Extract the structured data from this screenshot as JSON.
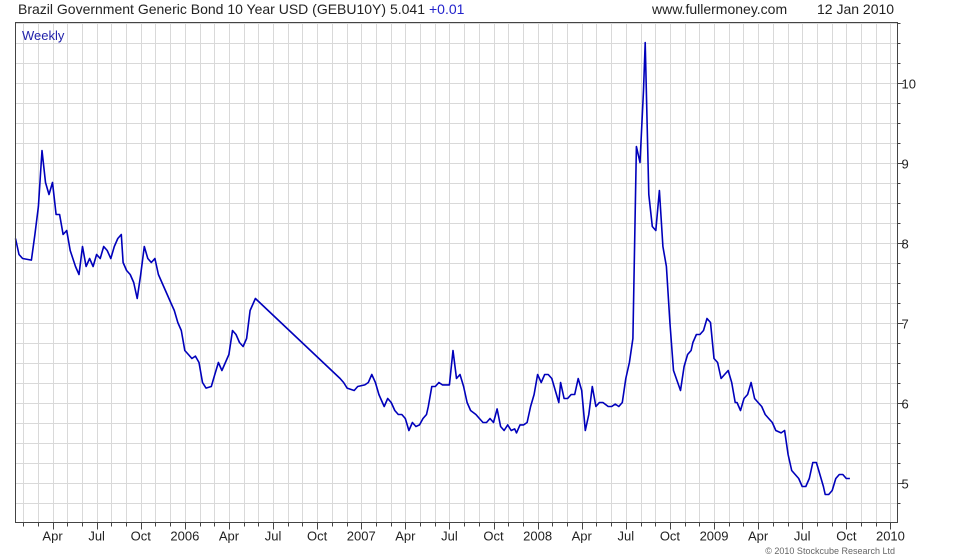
{
  "header": {
    "title": "Brazil Government Generic Bond 10 Year USD (GEBU10Y)",
    "last": "5.041",
    "change": "+0.01",
    "site": "www.fullermoney.com",
    "date": "12 Jan 2010"
  },
  "chart_label": "Weekly",
  "copyright": "© 2010 Stockcube Research Ltd",
  "colors": {
    "series": "#0000bb",
    "grid": "#d9d9d9",
    "frame": "#444444",
    "change": "#2222cc"
  },
  "chart_data": {
    "type": "line",
    "title": "Brazil Government Generic Bond 10 Year USD (GEBU10Y)",
    "xlabel": "",
    "ylabel": "",
    "x_range": [
      2005.04,
      2010.04
    ],
    "ylim": [
      4.5,
      10.75
    ],
    "y_ticks": [
      5,
      6,
      7,
      8,
      9,
      10
    ],
    "x_ticks": [
      {
        "label": "Apr",
        "x": 2005.25
      },
      {
        "label": "Jul",
        "x": 2005.5
      },
      {
        "label": "Oct",
        "x": 2005.75
      },
      {
        "label": "2006",
        "x": 2006.0
      },
      {
        "label": "Apr",
        "x": 2006.25
      },
      {
        "label": "Jul",
        "x": 2006.5
      },
      {
        "label": "Oct",
        "x": 2006.75
      },
      {
        "label": "2007",
        "x": 2007.0
      },
      {
        "label": "Apr",
        "x": 2007.25
      },
      {
        "label": "Jul",
        "x": 2007.5
      },
      {
        "label": "Oct",
        "x": 2007.75
      },
      {
        "label": "2008",
        "x": 2008.0
      },
      {
        "label": "Apr",
        "x": 2008.25
      },
      {
        "label": "Jul",
        "x": 2008.5
      },
      {
        "label": "Oct",
        "x": 2008.75
      },
      {
        "label": "2009",
        "x": 2009.0
      },
      {
        "label": "Apr",
        "x": 2009.25
      },
      {
        "label": "Jul",
        "x": 2009.5
      },
      {
        "label": "Oct",
        "x": 2009.75
      },
      {
        "label": "2010",
        "x": 2010.0
      }
    ],
    "grid": true,
    "y_axis_side": "right",
    "series": [
      {
        "values": [
          [
            2005.04,
            8.05
          ],
          [
            2005.06,
            7.85
          ],
          [
            2005.08,
            7.8
          ],
          [
            2005.13,
            7.78
          ],
          [
            2005.15,
            8.1
          ],
          [
            2005.17,
            8.45
          ],
          [
            2005.19,
            9.15
          ],
          [
            2005.21,
            8.75
          ],
          [
            2005.23,
            8.6
          ],
          [
            2005.25,
            8.75
          ],
          [
            2005.27,
            8.35
          ],
          [
            2005.29,
            8.35
          ],
          [
            2005.31,
            8.1
          ],
          [
            2005.33,
            8.15
          ],
          [
            2005.35,
            7.9
          ],
          [
            2005.38,
            7.7
          ],
          [
            2005.4,
            7.6
          ],
          [
            2005.42,
            7.95
          ],
          [
            2005.44,
            7.7
          ],
          [
            2005.46,
            7.8
          ],
          [
            2005.48,
            7.7
          ],
          [
            2005.5,
            7.85
          ],
          [
            2005.52,
            7.8
          ],
          [
            2005.54,
            7.95
          ],
          [
            2005.56,
            7.9
          ],
          [
            2005.58,
            7.8
          ],
          [
            2005.6,
            7.95
          ],
          [
            2005.62,
            8.05
          ],
          [
            2005.64,
            8.1
          ],
          [
            2005.65,
            7.75
          ],
          [
            2005.67,
            7.65
          ],
          [
            2005.69,
            7.6
          ],
          [
            2005.71,
            7.5
          ],
          [
            2005.73,
            7.3
          ],
          [
            2005.75,
            7.6
          ],
          [
            2005.77,
            7.95
          ],
          [
            2005.79,
            7.8
          ],
          [
            2005.81,
            7.75
          ],
          [
            2005.83,
            7.8
          ],
          [
            2005.85,
            7.6
          ],
          [
            2005.87,
            7.5
          ],
          [
            2005.9,
            7.35
          ],
          [
            2005.92,
            7.25
          ],
          [
            2005.94,
            7.15
          ],
          [
            2005.96,
            7.0
          ],
          [
            2005.98,
            6.9
          ],
          [
            2006.0,
            6.65
          ],
          [
            2006.02,
            6.6
          ],
          [
            2006.04,
            6.55
          ],
          [
            2006.06,
            6.58
          ],
          [
            2006.08,
            6.5
          ],
          [
            2006.1,
            6.25
          ],
          [
            2006.12,
            6.18
          ],
          [
            2006.15,
            6.2
          ],
          [
            2006.17,
            6.35
          ],
          [
            2006.19,
            6.5
          ],
          [
            2006.21,
            6.4
          ],
          [
            2006.23,
            6.5
          ],
          [
            2006.25,
            6.6
          ],
          [
            2006.27,
            6.9
          ],
          [
            2006.29,
            6.85
          ],
          [
            2006.31,
            6.75
          ],
          [
            2006.33,
            6.7
          ],
          [
            2006.35,
            6.8
          ],
          [
            2006.37,
            7.15
          ],
          [
            2006.4,
            7.3
          ],
          [
            2006.88,
            6.3
          ],
          [
            2006.9,
            6.25
          ],
          [
            2006.92,
            6.18
          ],
          [
            2006.96,
            6.15
          ],
          [
            2006.98,
            6.2
          ],
          [
            2007.02,
            6.22
          ],
          [
            2007.04,
            6.25
          ],
          [
            2007.06,
            6.35
          ],
          [
            2007.08,
            6.25
          ],
          [
            2007.1,
            6.1
          ],
          [
            2007.12,
            6.0
          ],
          [
            2007.13,
            5.95
          ],
          [
            2007.15,
            6.05
          ],
          [
            2007.17,
            6.0
          ],
          [
            2007.19,
            5.9
          ],
          [
            2007.21,
            5.85
          ],
          [
            2007.23,
            5.85
          ],
          [
            2007.25,
            5.8
          ],
          [
            2007.27,
            5.65
          ],
          [
            2007.29,
            5.75
          ],
          [
            2007.31,
            5.7
          ],
          [
            2007.33,
            5.72
          ],
          [
            2007.35,
            5.8
          ],
          [
            2007.37,
            5.85
          ],
          [
            2007.38,
            5.95
          ],
          [
            2007.4,
            6.2
          ],
          [
            2007.42,
            6.2
          ],
          [
            2007.44,
            6.25
          ],
          [
            2007.46,
            6.22
          ],
          [
            2007.5,
            6.22
          ],
          [
            2007.52,
            6.65
          ],
          [
            2007.54,
            6.3
          ],
          [
            2007.56,
            6.35
          ],
          [
            2007.58,
            6.2
          ],
          [
            2007.6,
            6.0
          ],
          [
            2007.62,
            5.9
          ],
          [
            2007.65,
            5.85
          ],
          [
            2007.67,
            5.8
          ],
          [
            2007.69,
            5.75
          ],
          [
            2007.71,
            5.75
          ],
          [
            2007.73,
            5.8
          ],
          [
            2007.75,
            5.75
          ],
          [
            2007.77,
            5.92
          ],
          [
            2007.79,
            5.7
          ],
          [
            2007.81,
            5.65
          ],
          [
            2007.83,
            5.72
          ],
          [
            2007.85,
            5.65
          ],
          [
            2007.87,
            5.67
          ],
          [
            2007.88,
            5.62
          ],
          [
            2007.9,
            5.72
          ],
          [
            2007.92,
            5.72
          ],
          [
            2007.94,
            5.75
          ],
          [
            2007.96,
            5.95
          ],
          [
            2007.98,
            6.1
          ],
          [
            2008.0,
            6.35
          ],
          [
            2008.02,
            6.25
          ],
          [
            2008.04,
            6.35
          ],
          [
            2008.06,
            6.35
          ],
          [
            2008.08,
            6.3
          ],
          [
            2008.12,
            6.0
          ],
          [
            2008.13,
            6.25
          ],
          [
            2008.15,
            6.05
          ],
          [
            2008.17,
            6.05
          ],
          [
            2008.19,
            6.1
          ],
          [
            2008.21,
            6.1
          ],
          [
            2008.23,
            6.3
          ],
          [
            2008.25,
            6.15
          ],
          [
            2008.27,
            5.65
          ],
          [
            2008.29,
            5.85
          ],
          [
            2008.31,
            6.2
          ],
          [
            2008.33,
            5.95
          ],
          [
            2008.35,
            6.0
          ],
          [
            2008.37,
            6.0
          ],
          [
            2008.4,
            5.95
          ],
          [
            2008.42,
            5.95
          ],
          [
            2008.44,
            5.98
          ],
          [
            2008.46,
            5.95
          ],
          [
            2008.48,
            6.0
          ],
          [
            2008.5,
            6.3
          ],
          [
            2008.52,
            6.5
          ],
          [
            2008.54,
            6.8
          ],
          [
            2008.56,
            9.2
          ],
          [
            2008.58,
            9.0
          ],
          [
            2008.6,
            9.9
          ],
          [
            2008.61,
            10.5
          ],
          [
            2008.63,
            8.6
          ],
          [
            2008.65,
            8.2
          ],
          [
            2008.67,
            8.15
          ],
          [
            2008.69,
            8.65
          ],
          [
            2008.71,
            7.95
          ],
          [
            2008.73,
            7.7
          ],
          [
            2008.75,
            7.0
          ],
          [
            2008.77,
            6.4
          ],
          [
            2008.81,
            6.15
          ],
          [
            2008.83,
            6.45
          ],
          [
            2008.85,
            6.6
          ],
          [
            2008.87,
            6.65
          ],
          [
            2008.88,
            6.75
          ],
          [
            2008.9,
            6.85
          ],
          [
            2008.92,
            6.85
          ],
          [
            2008.94,
            6.9
          ],
          [
            2008.96,
            7.05
          ],
          [
            2008.98,
            7.0
          ],
          [
            2009.0,
            6.55
          ],
          [
            2009.02,
            6.5
          ],
          [
            2009.04,
            6.3
          ],
          [
            2009.06,
            6.35
          ],
          [
            2009.08,
            6.4
          ],
          [
            2009.1,
            6.25
          ],
          [
            2009.12,
            6.0
          ],
          [
            2009.13,
            6.0
          ],
          [
            2009.15,
            5.9
          ],
          [
            2009.17,
            6.05
          ],
          [
            2009.19,
            6.1
          ],
          [
            2009.21,
            6.25
          ],
          [
            2009.23,
            6.05
          ],
          [
            2009.25,
            6.0
          ],
          [
            2009.27,
            5.95
          ],
          [
            2009.29,
            5.85
          ],
          [
            2009.31,
            5.8
          ],
          [
            2009.33,
            5.75
          ],
          [
            2009.35,
            5.65
          ],
          [
            2009.38,
            5.62
          ],
          [
            2009.4,
            5.65
          ],
          [
            2009.42,
            5.35
          ],
          [
            2009.44,
            5.15
          ],
          [
            2009.46,
            5.1
          ],
          [
            2009.48,
            5.05
          ],
          [
            2009.5,
            4.95
          ],
          [
            2009.52,
            4.95
          ],
          [
            2009.54,
            5.05
          ],
          [
            2009.56,
            5.25
          ],
          [
            2009.58,
            5.25
          ],
          [
            2009.6,
            5.1
          ],
          [
            2009.62,
            4.95
          ],
          [
            2009.63,
            4.85
          ],
          [
            2009.65,
            4.85
          ],
          [
            2009.67,
            4.9
          ],
          [
            2009.69,
            5.05
          ],
          [
            2009.71,
            5.1
          ],
          [
            2009.73,
            5.1
          ],
          [
            2009.75,
            5.05
          ],
          [
            2009.77,
            5.05
          ]
        ]
      }
    ]
  }
}
